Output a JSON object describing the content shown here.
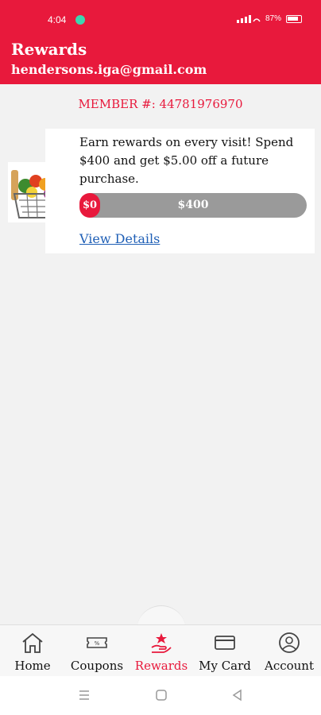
{
  "status": {
    "time": "4:04",
    "battery": "87%"
  },
  "header": {
    "title": "Rewards",
    "email": "hendersons.iga@gmail.com"
  },
  "member": {
    "text": "MEMBER #: 44781976970"
  },
  "reward": {
    "description": "Earn rewards on every visit! Spend $400 and get $5.00 off a future purchase.",
    "start_label": "$0",
    "goal_label": "$400",
    "progress_fraction": 0,
    "link": "View Details"
  },
  "nav": {
    "items": [
      {
        "label": "Home",
        "icon": "home-icon"
      },
      {
        "label": "Coupons",
        "icon": "coupon-icon"
      },
      {
        "label": "Rewards",
        "icon": "rewards-icon"
      },
      {
        "label": "My Card",
        "icon": "card-icon"
      },
      {
        "label": "Account",
        "icon": "account-icon"
      }
    ],
    "active": "Rewards"
  },
  "colors": {
    "brand": "#e8193c",
    "link": "#1f5fb6",
    "progress_track": "#9a9a9a"
  }
}
